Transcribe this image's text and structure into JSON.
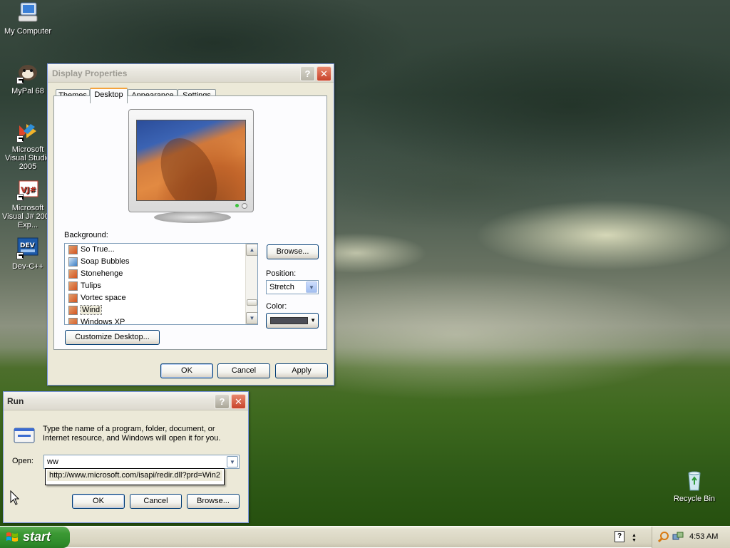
{
  "desktop": {
    "icons": [
      {
        "label": "My Computer"
      },
      {
        "label": "MyPal 68"
      },
      {
        "label": "Microsoft Visual Studio 2005"
      },
      {
        "label": "Microsoft Visual J# 2005 Exp..."
      },
      {
        "label": "Dev-C++"
      },
      {
        "label": "Recycle Bin"
      }
    ]
  },
  "display_properties": {
    "title": "Display Properties",
    "tabs": [
      "Themes",
      "Desktop",
      "Appearance",
      "Settings"
    ],
    "selected_tab": "Desktop",
    "background_label": "Background:",
    "backgrounds": [
      {
        "name": "So True...",
        "icon": "image-file-icon"
      },
      {
        "name": "Soap Bubbles",
        "icon": "image-file-icon"
      },
      {
        "name": "Stonehenge",
        "icon": "image-file-icon"
      },
      {
        "name": "Tulips",
        "icon": "image-file-icon"
      },
      {
        "name": "Vortec space",
        "icon": "image-file-icon"
      },
      {
        "name": "Wind",
        "icon": "image-file-icon"
      },
      {
        "name": "Windows XP",
        "icon": "image-file-icon"
      }
    ],
    "selected_background": "Wind",
    "browse_label": "Browse...",
    "position_label": "Position:",
    "position_value": "Stretch",
    "color_label": "Color:",
    "color_value": "#4b4d56",
    "customize_label": "Customize Desktop...",
    "ok_label": "OK",
    "cancel_label": "Cancel",
    "apply_label": "Apply"
  },
  "run_dialog": {
    "title": "Run",
    "description": "Type the name of a program, folder, document, or Internet resource, and Windows will open it for you.",
    "open_label": "Open:",
    "open_value": "ww",
    "autocomplete": "http://www.microsoft.com/isapi/redir.dll?prd=Win2",
    "ok_label": "OK",
    "cancel_label": "Cancel",
    "browse_label": "Browse..."
  },
  "taskbar": {
    "start_label": "start",
    "clock": "4:53 AM"
  },
  "colors": {
    "xp_blue_border": "#7a96df",
    "start_green": "#3c9a34",
    "window_face": "#ece9d8"
  }
}
